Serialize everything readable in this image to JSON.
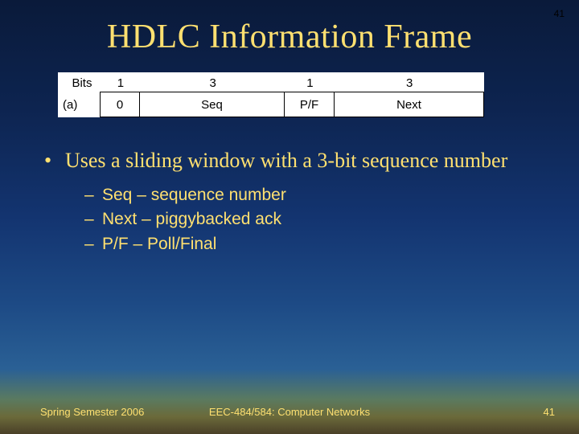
{
  "page_number_top": "41",
  "title": "HDLC Information Frame",
  "diagram": {
    "bits_label": "Bits",
    "row_label": "(a)",
    "columns": [
      {
        "bits": "1",
        "field": "0"
      },
      {
        "bits": "3",
        "field": "Seq"
      },
      {
        "bits": "1",
        "field": "P/F"
      },
      {
        "bits": "3",
        "field": "Next"
      }
    ]
  },
  "bullet_main": "Uses a sliding window with a 3-bit sequence number",
  "sub_bullets": [
    "Seq – sequence number",
    "Next – piggybacked ack",
    "P/F – Poll/Final"
  ],
  "footer": {
    "left": "Spring Semester 2006",
    "center": "EEC-484/584: Computer Networks",
    "right": "41"
  }
}
